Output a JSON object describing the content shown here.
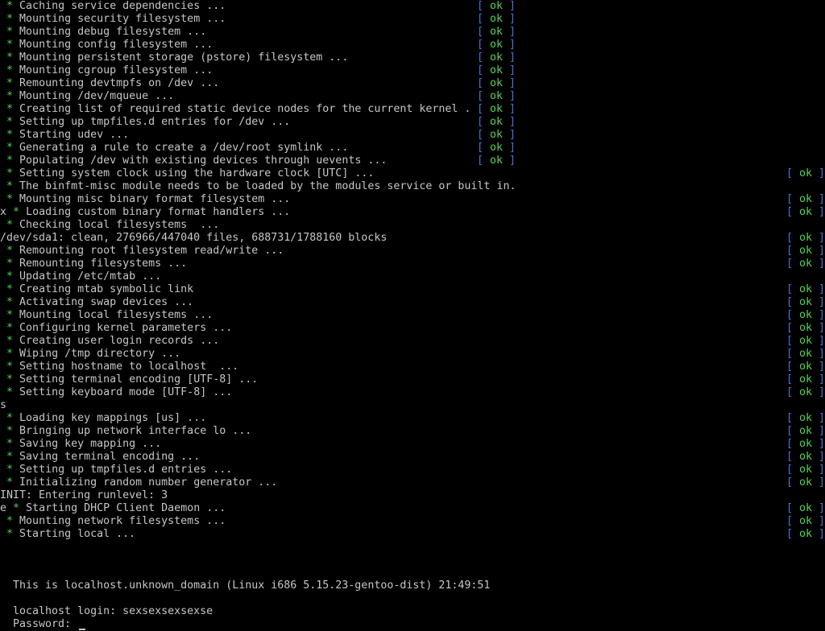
{
  "boot_lines": [
    {
      "prefix": "",
      "star": "*",
      "text": "Caching service dependencies ...",
      "status": "ok",
      "col": 1
    },
    {
      "prefix": "",
      "star": "*",
      "text": "Mounting security filesystem ...",
      "status": "ok",
      "col": 1
    },
    {
      "prefix": "",
      "star": "*",
      "text": "Mounting debug filesystem ...",
      "status": "ok",
      "col": 1
    },
    {
      "prefix": "",
      "star": "*",
      "text": "Mounting config filesystem ...",
      "status": "ok",
      "col": 1
    },
    {
      "prefix": "",
      "star": "*",
      "text": "Mounting persistent storage (pstore) filesystem ...",
      "status": "ok",
      "col": 1
    },
    {
      "prefix": "",
      "star": "*",
      "text": "Mounting cgroup filesystem ...",
      "status": "ok",
      "col": 1
    },
    {
      "prefix": "",
      "star": "*",
      "text": "Remounting devtmpfs on /dev ...",
      "status": "ok",
      "col": 1
    },
    {
      "prefix": "",
      "star": "*",
      "text": "Mounting /dev/mqueue ...",
      "status": "ok",
      "col": 1
    },
    {
      "prefix": "",
      "star": "*",
      "text": "Creating list of required static device nodes for the current kernel .",
      "status": "ok",
      "col": 1
    },
    {
      "prefix": "",
      "star": "*",
      "text": "Setting up tmpfiles.d entries for /dev ...",
      "status": "ok",
      "col": 1
    },
    {
      "prefix": "",
      "star": "*",
      "text": "Starting udev ...",
      "status": "ok",
      "col": 1
    },
    {
      "prefix": "",
      "star": "*",
      "text": "Generating a rule to create a /dev/root symlink ...",
      "status": "ok",
      "col": 1
    },
    {
      "prefix": "",
      "star": "*",
      "text": "Populating /dev with existing devices through uevents ...",
      "status": "ok",
      "col": 1
    },
    {
      "prefix": "",
      "star": "*",
      "text": "Setting system clock using the hardware clock [UTC] ...",
      "status": "ok",
      "col": 2
    },
    {
      "prefix": "",
      "star": "*",
      "text": "The binfmt-misc module needs to be loaded by the modules service or built in.",
      "status": "",
      "col": 0
    },
    {
      "prefix": "",
      "star": "*",
      "text": "Mounting misc binary format filesystem ...",
      "status": "ok",
      "col": 2
    },
    {
      "prefix": "x",
      "star": "*",
      "text": "Loading custom binary format handlers ...",
      "status": "ok",
      "col": 2
    },
    {
      "prefix": "",
      "star": "*",
      "text": "Checking local filesystems  ...",
      "status": "",
      "col": 0
    },
    {
      "prefix": "",
      "star": "",
      "text": "/dev/sda1: clean, 276966/447040 files, 688731/1788160 blocks",
      "status": "ok",
      "col": 2
    },
    {
      "prefix": "",
      "star": "*",
      "text": "Remounting root filesystem read/write ...",
      "status": "ok",
      "col": 2
    },
    {
      "prefix": "",
      "star": "*",
      "text": "Remounting filesystems ...",
      "status": "ok",
      "col": 2
    },
    {
      "prefix": "",
      "star": "*",
      "text": "Updating /etc/mtab ...",
      "status": "",
      "col": 0
    },
    {
      "prefix": "",
      "star": "*",
      "text": "Creating mtab symbolic link",
      "status": "ok",
      "col": 2
    },
    {
      "prefix": "",
      "star": "*",
      "text": "Activating swap devices ...",
      "status": "ok",
      "col": 2
    },
    {
      "prefix": "",
      "star": "*",
      "text": "Mounting local filesystems ...",
      "status": "ok",
      "col": 2
    },
    {
      "prefix": "",
      "star": "*",
      "text": "Configuring kernel parameters ...",
      "status": "ok",
      "col": 2
    },
    {
      "prefix": "",
      "star": "*",
      "text": "Creating user login records ...",
      "status": "ok",
      "col": 2
    },
    {
      "prefix": "",
      "star": "*",
      "text": "Wiping /tmp directory ...",
      "status": "ok",
      "col": 2
    },
    {
      "prefix": "",
      "star": "*",
      "text": "Setting hostname to localhost  ...",
      "status": "ok",
      "col": 2
    },
    {
      "prefix": "",
      "star": "*",
      "text": "Setting terminal encoding [UTF-8] ...",
      "status": "ok",
      "col": 2
    },
    {
      "prefix": "",
      "star": "*",
      "text": "Setting keyboard mode [UTF-8] ...",
      "status": "ok",
      "col": 2
    },
    {
      "prefix": "",
      "star": "",
      "text": "s",
      "status": "",
      "col": 0
    },
    {
      "prefix": "",
      "star": "*",
      "text": "Loading key mappings [us] ...",
      "status": "ok",
      "col": 2
    },
    {
      "prefix": "",
      "star": "*",
      "text": "Bringing up network interface lo ...",
      "status": "ok",
      "col": 2
    },
    {
      "prefix": "",
      "star": "*",
      "text": "Saving key mapping ...",
      "status": "ok",
      "col": 2
    },
    {
      "prefix": "",
      "star": "*",
      "text": "Saving terminal encoding ...",
      "status": "ok",
      "col": 2
    },
    {
      "prefix": "",
      "star": "*",
      "text": "Setting up tmpfiles.d entries ...",
      "status": "ok",
      "col": 2
    },
    {
      "prefix": "",
      "star": "*",
      "text": "Initializing random number generator ...",
      "status": "ok",
      "col": 2
    },
    {
      "prefix": "",
      "star": "",
      "text": "INIT: Entering runlevel: 3",
      "status": "",
      "col": 0
    },
    {
      "prefix": "e",
      "star": "*",
      "text": "Starting DHCP Client Daemon ...",
      "status": "ok",
      "col": 2
    },
    {
      "prefix": "",
      "star": "*",
      "text": "Mounting network filesystems ...",
      "status": "ok",
      "col": 2
    },
    {
      "prefix": "",
      "star": "*",
      "text": "Starting local ...",
      "status": "ok",
      "col": 2
    }
  ],
  "banner": "This is localhost.unknown_domain (Linux i686 5.15.23-gentoo-dist) 21:49:51",
  "login_prompt": "localhost login: sexsexsexsexse",
  "password_prompt": "Password: ",
  "status_open": "[ ",
  "status_close": " ]",
  "colors": {
    "bracket": "#4f6fd8",
    "ok": "#54d254",
    "star": "#54d254",
    "text": "#c6c6c6",
    "background": "#000000"
  }
}
